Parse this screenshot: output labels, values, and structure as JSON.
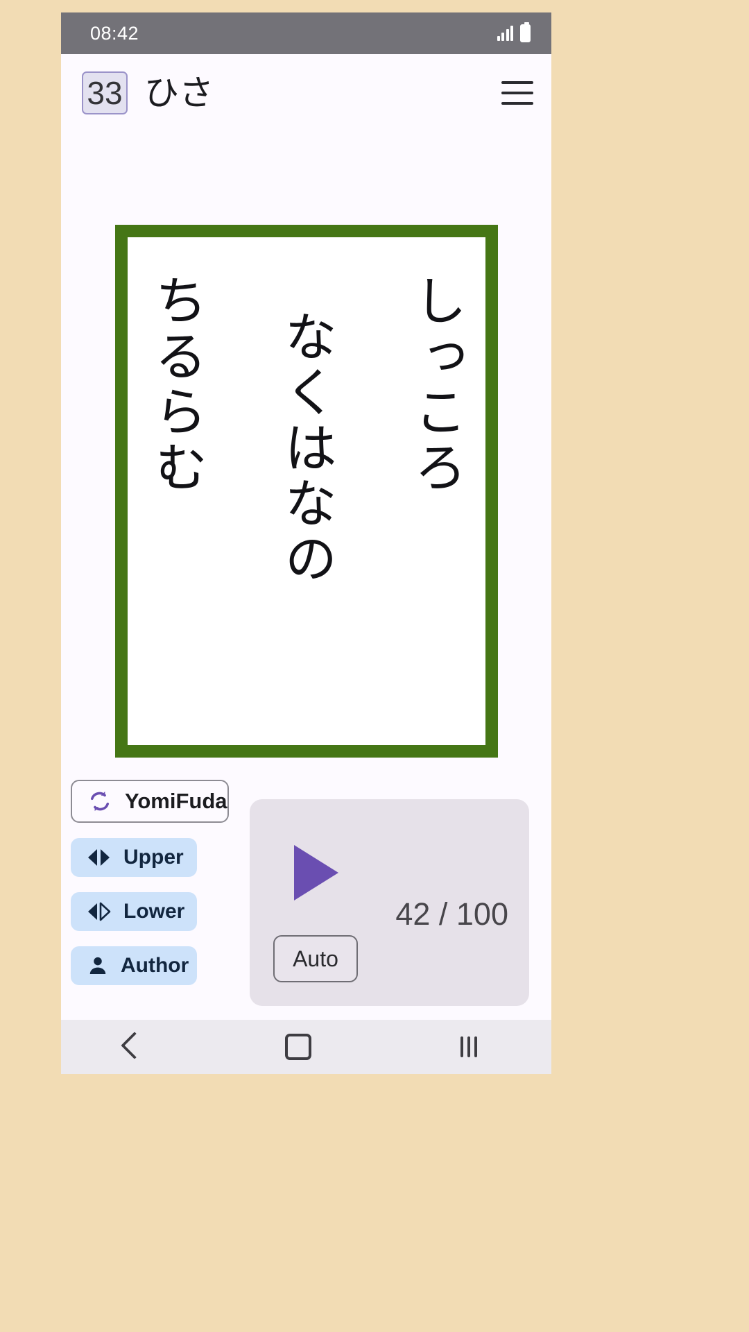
{
  "status_bar": {
    "clock": "08:42",
    "signal_icon": "signal-bars-icon",
    "battery_icon": "battery-icon"
  },
  "app_bar": {
    "poem_number": "33",
    "poem_title": "ひさ",
    "menu_icon": "hamburger-menu-icon"
  },
  "card": {
    "border_color": "#457615",
    "background_color": "#ffffff",
    "columns": [
      "しっころ",
      "なくはなの",
      "ちるらむ"
    ]
  },
  "controls": {
    "yomifuda": {
      "label": "YomiFuda",
      "icon": "sync-refresh-icon",
      "icon_color": "#6a4eb1"
    },
    "modes": [
      {
        "label": "Upper",
        "icon": "prev-next-arrows-icon"
      },
      {
        "label": "Lower",
        "icon": "prev-next-arrows-outline-icon"
      },
      {
        "label": "Author",
        "icon": "person-icon"
      }
    ],
    "player": {
      "play_icon": "play-triangle-icon",
      "play_color": "#6a4eb1",
      "counter": "42 / 100",
      "auto_label": "Auto",
      "panel_color": "#e6e1e9"
    }
  },
  "nav_bar": {
    "back_icon": "back-chevron-icon",
    "home_icon": "home-square-icon",
    "recents_icon": "recents-bars-icon"
  }
}
